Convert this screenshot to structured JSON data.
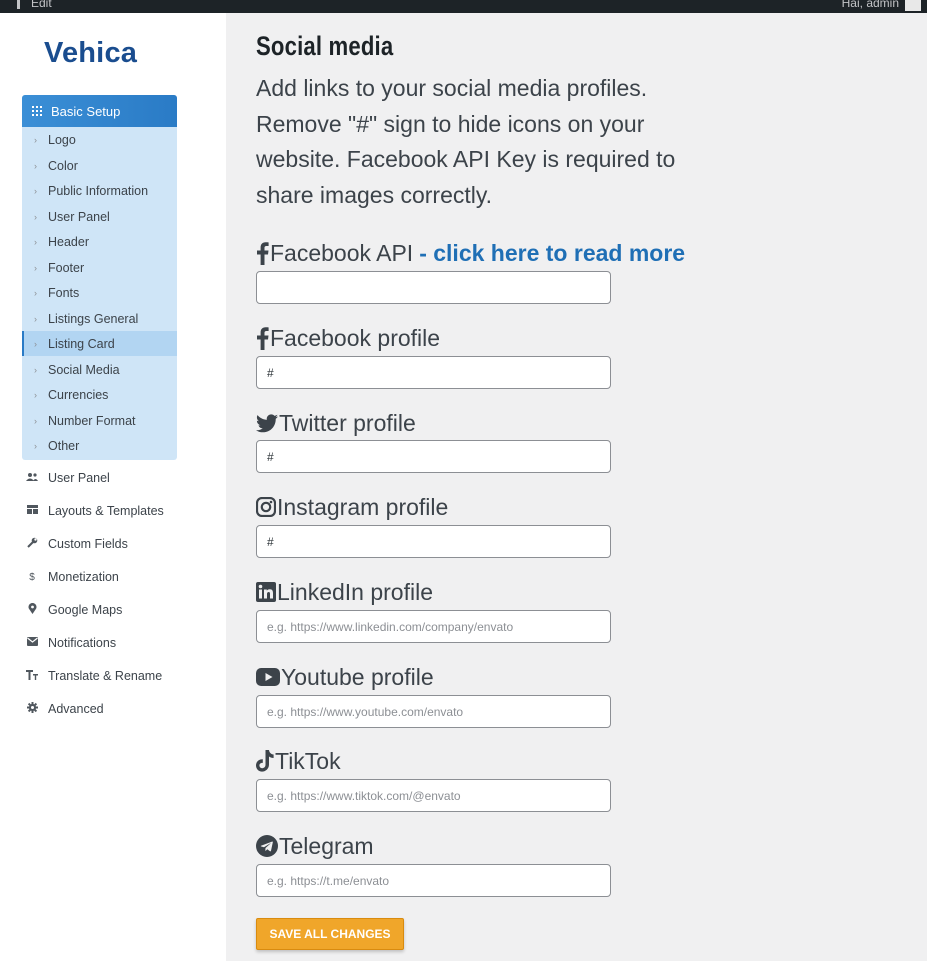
{
  "admin_bar": {
    "left_label": "Edit",
    "greeting": "Hai, admin"
  },
  "logo": "Vehica",
  "sidebar": {
    "section_title": "Basic Setup",
    "submenu": [
      {
        "label": "Logo"
      },
      {
        "label": "Color"
      },
      {
        "label": "Public Information"
      },
      {
        "label": "User Panel"
      },
      {
        "label": "Header"
      },
      {
        "label": "Footer"
      },
      {
        "label": "Fonts"
      },
      {
        "label": "Listings General"
      },
      {
        "label": "Listing Card",
        "active": true
      },
      {
        "label": "Social Media"
      },
      {
        "label": "Currencies"
      },
      {
        "label": "Number Format"
      },
      {
        "label": "Other"
      }
    ],
    "main_items": [
      {
        "label": "User Panel",
        "icon": "users-icon"
      },
      {
        "label": "Layouts & Templates",
        "icon": "layout-icon"
      },
      {
        "label": "Custom Fields",
        "icon": "wrench-icon"
      },
      {
        "label": "Monetization",
        "icon": "dollar-icon"
      },
      {
        "label": "Google Maps",
        "icon": "map-pin-icon"
      },
      {
        "label": "Notifications",
        "icon": "mail-icon"
      },
      {
        "label": "Translate & Rename",
        "icon": "text-size-icon"
      },
      {
        "label": "Advanced",
        "icon": "gear-icon"
      }
    ]
  },
  "content": {
    "title": "Social media",
    "intro": "Add links to your social media profiles. Remove \"#\" sign to hide icons on your website. Facebook API Key is required to share images correctly.",
    "fields": [
      {
        "label": "Facebook API",
        "link": "- click here to read more",
        "value": "",
        "placeholder": "",
        "icon": "facebook-icon"
      },
      {
        "label": "Facebook profile",
        "value": "#",
        "placeholder": "",
        "icon": "facebook-icon"
      },
      {
        "label": "Twitter profile",
        "value": "#",
        "placeholder": "",
        "icon": "twitter-icon"
      },
      {
        "label": "Instagram profile",
        "value": "#",
        "placeholder": "",
        "icon": "instagram-icon"
      },
      {
        "label": "LinkedIn profile",
        "value": "",
        "placeholder": "e.g. https://www.linkedin.com/company/envato",
        "icon": "linkedin-icon"
      },
      {
        "label": "Youtube profile",
        "value": "",
        "placeholder": "e.g. https://www.youtube.com/envato",
        "icon": "youtube-icon"
      },
      {
        "label": "TikTok",
        "value": "",
        "placeholder": "e.g. https://www.tiktok.com/@envato",
        "icon": "tiktok-icon"
      },
      {
        "label": "Telegram",
        "value": "",
        "placeholder": "e.g. https://t.me/envato",
        "icon": "telegram-icon"
      }
    ],
    "save_label": "SAVE ALL CHANGES"
  },
  "colors": {
    "accent": "#2a7bc6",
    "button": "#f0a62a",
    "link": "#1f6fb5"
  }
}
